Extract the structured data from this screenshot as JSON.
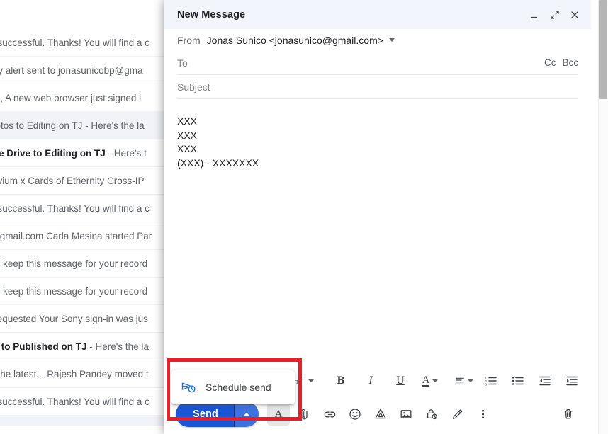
{
  "mail_list": {
    "rows": [
      {
        "kind": "read",
        "text": "s successful. Thanks! You will find a c"
      },
      {
        "kind": "read",
        "text": "rity alert sent to jonasunicobp@gma"
      },
      {
        "kind": "read",
        "text": "as, A new web browser just signed i"
      },
      {
        "kind": "sel",
        "text": "hotos to Editing on TJ - Here's the la"
      },
      {
        "kind": "unread",
        "bold": "gle Drive to Editing on TJ",
        "rest": " - Here's t"
      },
      {
        "kind": "read",
        "text": "luvium x Cards of Ethernity Cross-IP"
      },
      {
        "kind": "read",
        "text": "s successful. Thanks! You will find a c"
      },
      {
        "kind": "read",
        "text": "@gmail.com Carla Mesina started Par"
      },
      {
        "kind": "read",
        "text": "se keep this message for your record"
      },
      {
        "kind": "read",
        "text": "se keep this message for your record"
      },
      {
        "kind": "read",
        "text": " Requested Your Sony sign-in was jus"
      },
      {
        "kind": "unread",
        "bold": "m to Published on TJ",
        "rest": " - Here's the la"
      },
      {
        "kind": "read",
        "text": "s the latest... Rajesh Pandey moved t"
      },
      {
        "kind": "read",
        "text": "s successful. Thanks! You will find a c"
      }
    ]
  },
  "compose": {
    "title": "New Message",
    "window_controls": {
      "minimize": "minimize-icon",
      "expand": "expand-icon",
      "close": "close-icon"
    },
    "from": {
      "label": "From",
      "value": "Jonas Sunico <jonasunico@gmail.com>"
    },
    "to": {
      "label": "To",
      "value": "",
      "cc": "Cc",
      "bcc": "Bcc"
    },
    "subject": {
      "placeholder": "Subject",
      "value": ""
    },
    "body_lines": [
      "XXX",
      "XXX",
      "XXX",
      "(XXX) - XXXXXXX"
    ]
  },
  "format_toolbar": {
    "items": [
      {
        "name": "font-family-dropdown",
        "glyph": "",
        "caret": true
      },
      {
        "name": "font-size-icon",
        "glyph": "тT",
        "caret": true
      },
      {
        "name": "bold-icon",
        "glyph": "B"
      },
      {
        "name": "italic-icon",
        "glyph": "I"
      },
      {
        "name": "underline-icon",
        "glyph": "U"
      },
      {
        "name": "text-color-icon",
        "glyph": "A",
        "caret": true
      },
      {
        "name": "align-icon",
        "glyph": "align",
        "caret": true
      },
      {
        "name": "numbered-list-icon",
        "glyph": "ol"
      },
      {
        "name": "bulleted-list-icon",
        "glyph": "ul"
      },
      {
        "name": "decrease-indent-icon",
        "glyph": "outdent"
      },
      {
        "name": "increase-indent-icon",
        "glyph": "indent"
      },
      {
        "name": "more-format-options-icon",
        "glyph": "",
        "caret": true
      }
    ]
  },
  "action_bar": {
    "send_label": "Send",
    "send_options_icon": "chevron-up-icon",
    "icons": [
      {
        "name": "formatting-options-icon",
        "glyph": "A",
        "active": true
      },
      {
        "name": "attach-file-icon",
        "glyph": "paperclip"
      },
      {
        "name": "insert-link-icon",
        "glyph": "link"
      },
      {
        "name": "insert-emoji-icon",
        "glyph": "emoji"
      },
      {
        "name": "insert-drive-file-icon",
        "glyph": "drive"
      },
      {
        "name": "insert-photo-icon",
        "glyph": "image"
      },
      {
        "name": "confidential-mode-icon",
        "glyph": "lock-clock"
      },
      {
        "name": "insert-signature-icon",
        "glyph": "pen"
      },
      {
        "name": "more-options-icon",
        "glyph": "kebab"
      }
    ],
    "discard_icon": "trash-icon"
  },
  "schedule_popup": {
    "item_label": "Schedule send",
    "item_icon": "schedule-send-icon"
  },
  "annotation": {
    "type": "rectangle-highlight",
    "color": "#ee1c25"
  },
  "colors": {
    "send_blue": "#1a56d6",
    "send_arrow_blue": "#3d72e0",
    "header_bg": "#f2f6fc",
    "annotation_red": "#ee1c25",
    "selected_row": "#f2f3f8",
    "text_primary": "#202124",
    "text_secondary": "#5f6368"
  }
}
